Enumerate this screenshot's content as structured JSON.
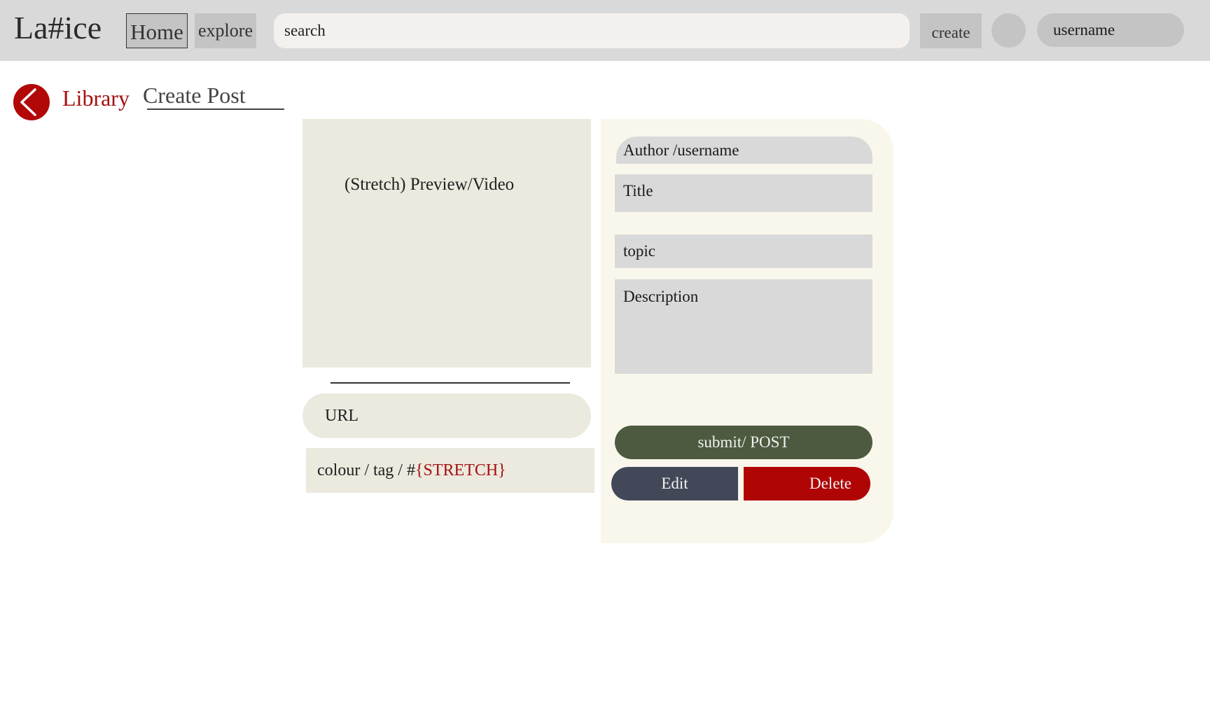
{
  "header": {
    "logo": "La#ice",
    "home_label": "Home",
    "explore_label": "explore",
    "search_placeholder": "search",
    "create_label": "create",
    "username": "username"
  },
  "breadcrumb": {
    "library": "Library",
    "current": "Create Post"
  },
  "media": {
    "preview_label": "(Stretch) Preview/Video",
    "url_label": "URL",
    "tag_prefix": "colour / tag / #",
    "tag_stretch": "{STRETCH}"
  },
  "form": {
    "author": "Author /username",
    "title": "Title",
    "topic": "topic",
    "description": "Description",
    "submit_label": "submit/ POST",
    "edit_label": "Edit",
    "delete_label": "Delete"
  },
  "colors": {
    "accent_red": "#b20808",
    "submit_green": "#4d5a40",
    "edit_slate": "#434858",
    "panel_bg": "#f9f7ec",
    "media_bg": "#ece9de"
  },
  "icons": {
    "back": "back-arrow-icon"
  }
}
